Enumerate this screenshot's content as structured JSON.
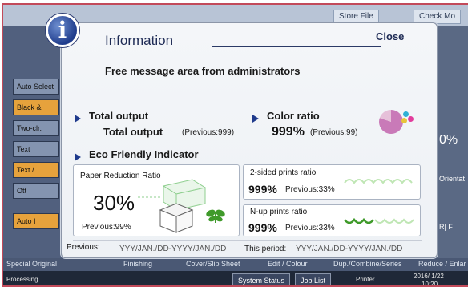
{
  "background": {
    "top_tabs": [
      "Store File",
      "Check Mo"
    ],
    "left_buttons": [
      "Auto Select",
      "Black &",
      "Two-clr.",
      "Text",
      "Text /",
      "Ott",
      "Auto I"
    ],
    "right_labels": [
      "0%",
      "Orientat",
      "R| F"
    ],
    "bottom_row": [
      "Special Original",
      "Finishing",
      "Cover/Slip Sheet",
      "Edit / Colour",
      "Dup./Combine/Series",
      "Reduce / Enlar"
    ],
    "status": {
      "left": "Processing...",
      "system_status": "System Status",
      "job_list": "Job List",
      "printer": "Printer",
      "date": "2016/ 1/22",
      "time": "10:20"
    }
  },
  "dialog": {
    "title": "Information",
    "close_label": "Close",
    "message": "Free message area from administrators",
    "total_output": {
      "heading": "Total output",
      "label": "Total output",
      "previous": "(Previous:999)"
    },
    "color_ratio": {
      "heading": "Color ratio",
      "value": "999%",
      "previous": "(Previous:99)"
    },
    "eco": {
      "heading": "Eco Friendly Indicator",
      "paper_reduction": {
        "title": "Paper Reduction Ratio",
        "value": "30%",
        "previous": "Previous:99%"
      },
      "two_sided": {
        "title": "2-sided prints ratio",
        "value": "999%",
        "previous": "Previous:33%"
      },
      "n_up": {
        "title": "N-up prints ratio",
        "value": "999%",
        "previous": "Previous:33%"
      }
    },
    "footer": {
      "previous_label": "Previous:",
      "previous_period": "YYY/JAN./DD-YYYY/JAN./DD",
      "this_period_label": "This period:",
      "this_period": "YYY/JAN./DD-YYYY/JAN./DD"
    }
  },
  "colors": {
    "accent": "#1f3a8c",
    "plant_green": "#3f9a2a",
    "pie_main": "#c97ab8"
  }
}
